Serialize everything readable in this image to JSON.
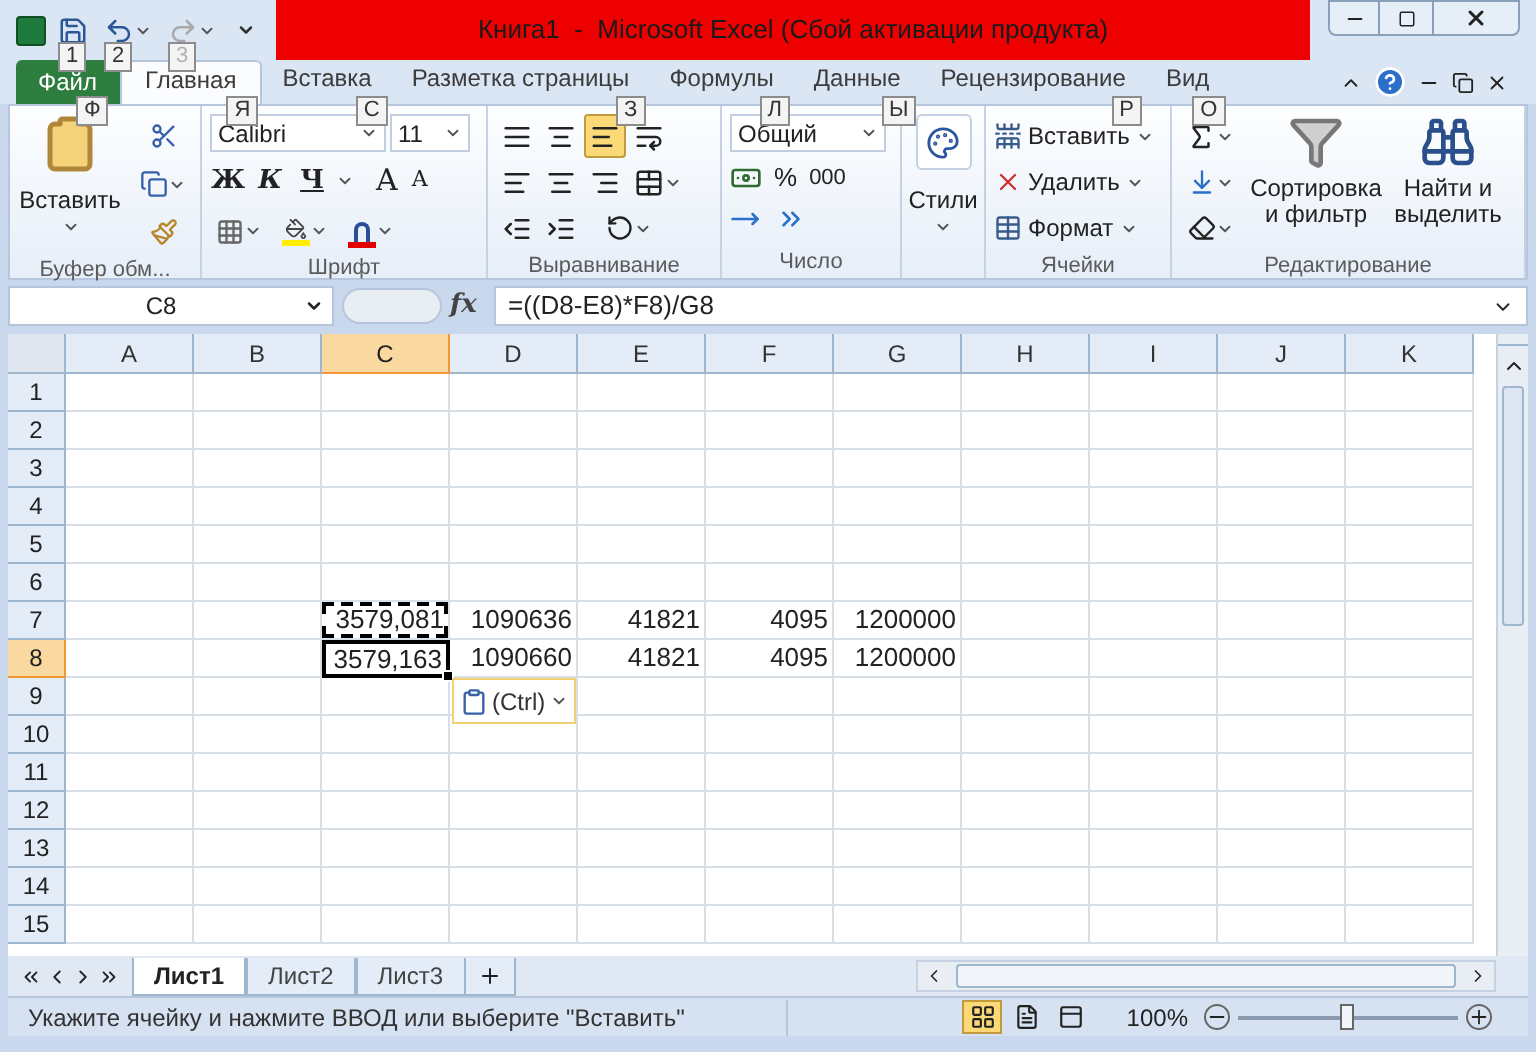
{
  "title_bar": {
    "title": "Книга1  -  Microsoft Excel (Сбой активации продукта)",
    "quick_access": [
      {
        "kind": "save",
        "keytip": "1",
        "disabled": false
      },
      {
        "kind": "undo",
        "keytip": "2",
        "disabled": false
      },
      {
        "kind": "redo",
        "keytip": "3",
        "disabled": true
      }
    ]
  },
  "tabs": [
    {
      "label": "Файл",
      "keytip": "Ф",
      "kind": "file",
      "selected": false
    },
    {
      "label": "Главная",
      "keytip": "Я",
      "kind": "tab",
      "selected": true
    },
    {
      "label": "Вставка",
      "keytip": "С",
      "kind": "tab",
      "selected": false
    },
    {
      "label": "Разметка страницы",
      "keytip": "З",
      "kind": "tab",
      "selected": false
    },
    {
      "label": "Формулы",
      "keytip": "Л",
      "kind": "tab",
      "selected": false
    },
    {
      "label": "Данные",
      "keytip": "Ы",
      "kind": "tab",
      "selected": false
    },
    {
      "label": "Рецензирование",
      "keytip": "Р",
      "kind": "tab",
      "selected": false
    },
    {
      "label": "Вид",
      "keytip": "О",
      "kind": "tab",
      "selected": false
    }
  ],
  "ribbon": {
    "clipboard": {
      "title": "Буфер обм...",
      "paste": "Вставить"
    },
    "font": {
      "title": "Шрифт",
      "font_name": "Calibri",
      "font_size": "11",
      "bold": "Ж",
      "italic": "К",
      "underline": "Ч",
      "grow": "A",
      "shrink": "A"
    },
    "alignment": {
      "title": "Выравнивание",
      "vertical": [
        {
          "kind": "top",
          "selected": false
        },
        {
          "kind": "middle",
          "selected": false
        },
        {
          "kind": "bottom",
          "selected": true
        }
      ]
    },
    "number": {
      "title": "Число",
      "format": "Общий",
      "percent": "%",
      "thousands": "000"
    },
    "styles": {
      "title": "Стили"
    },
    "cells": {
      "title": "Ячейки",
      "items": [
        {
          "kind": "insert",
          "label": "Вставить"
        },
        {
          "kind": "delete",
          "label": "Удалить"
        },
        {
          "kind": "format",
          "label": "Формат"
        }
      ]
    },
    "editing": {
      "title": "Редактирование",
      "sort": "Сортировка и фильтр",
      "find": "Найти и выделить"
    }
  },
  "formula_bar": {
    "name_box": "C8",
    "fx": "fx",
    "formula": "=((D8-E8)*F8)/G8"
  },
  "sheet": {
    "columns": [
      {
        "label": "A",
        "selected": false
      },
      {
        "label": "B",
        "selected": false
      },
      {
        "label": "C",
        "selected": true
      },
      {
        "label": "D",
        "selected": false
      },
      {
        "label": "E",
        "selected": false
      },
      {
        "label": "F",
        "selected": false
      },
      {
        "label": "G",
        "selected": false
      },
      {
        "label": "H",
        "selected": false
      },
      {
        "label": "I",
        "selected": false
      },
      {
        "label": "J",
        "selected": false
      },
      {
        "label": "K",
        "selected": false
      }
    ],
    "rows": [
      {
        "label": "1",
        "selected": false
      },
      {
        "label": "2",
        "selected": false
      },
      {
        "label": "3",
        "selected": false
      },
      {
        "label": "4",
        "selected": false
      },
      {
        "label": "5",
        "selected": false
      },
      {
        "label": "6",
        "selected": false
      },
      {
        "label": "7",
        "selected": false,
        "cells": {
          "C": {
            "value": "3579,081",
            "copied": true,
            "active": false
          },
          "D": {
            "value": "1090636",
            "copied": false,
            "active": false
          },
          "E": {
            "value": "41821",
            "copied": false,
            "active": false
          },
          "F": {
            "value": "4095",
            "copied": false,
            "active": false
          },
          "G": {
            "value": "1200000",
            "copied": false,
            "active": false
          }
        }
      },
      {
        "label": "8",
        "selected": true,
        "cells": {
          "C": {
            "value": "3579,163",
            "copied": false,
            "active": true
          },
          "D": {
            "value": "1090660",
            "copied": false,
            "active": false
          },
          "E": {
            "value": "41821",
            "copied": false,
            "active": false
          },
          "F": {
            "value": "4095",
            "copied": false,
            "active": false
          },
          "G": {
            "value": "1200000",
            "copied": false,
            "active": false
          }
        }
      },
      {
        "label": "9",
        "selected": false
      },
      {
        "label": "10",
        "selected": false
      },
      {
        "label": "11",
        "selected": false
      },
      {
        "label": "12",
        "selected": false
      },
      {
        "label": "13",
        "selected": false
      },
      {
        "label": "14",
        "selected": false
      },
      {
        "label": "15",
        "selected": false
      }
    ],
    "paste_options": {
      "label": "(Ctrl)"
    }
  },
  "sheet_tabs": [
    {
      "label": "Лист1",
      "selected": true
    },
    {
      "label": "Лист2",
      "selected": false
    },
    {
      "label": "Лист3",
      "selected": false
    }
  ],
  "status_bar": {
    "message": "Укажите ячейку и нажмите ВВОД или выберите \"Вставить\"",
    "views": [
      {
        "kind": "normal",
        "selected": true
      },
      {
        "kind": "page_layout",
        "selected": false
      },
      {
        "kind": "page_break",
        "selected": false
      }
    ],
    "zoom": "100%",
    "zoom_level": {
      "level": 0.5
    }
  }
}
